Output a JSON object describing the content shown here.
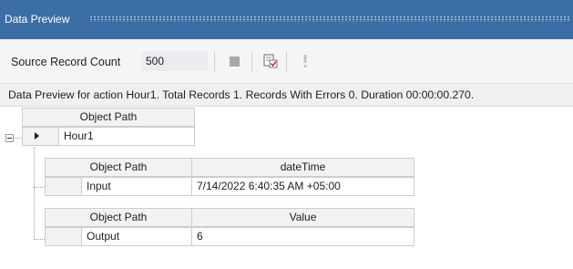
{
  "panel": {
    "title": "Data Preview"
  },
  "toolbar": {
    "source_record_count_label": "Source Record Count",
    "source_record_count_value": "500"
  },
  "status": {
    "text": "Data Preview for action Hour1. Total Records 1. Records With Errors 0. Duration 00:00:00.270."
  },
  "grid": {
    "root": {
      "header": "Object Path",
      "row_value": "Hour1"
    },
    "children": [
      {
        "headers": [
          "Object Path",
          "dateTime"
        ],
        "values": [
          "Input",
          "7/14/2022 6:40:35 AM +05:00"
        ]
      },
      {
        "headers": [
          "Object Path",
          "Value"
        ],
        "values": [
          "Output",
          "6"
        ]
      }
    ]
  },
  "icons": [
    "stop-icon",
    "preview-check-icon",
    "exclamation-icon",
    "expander-minus-icon",
    "row-current-arrow-icon"
  ]
}
